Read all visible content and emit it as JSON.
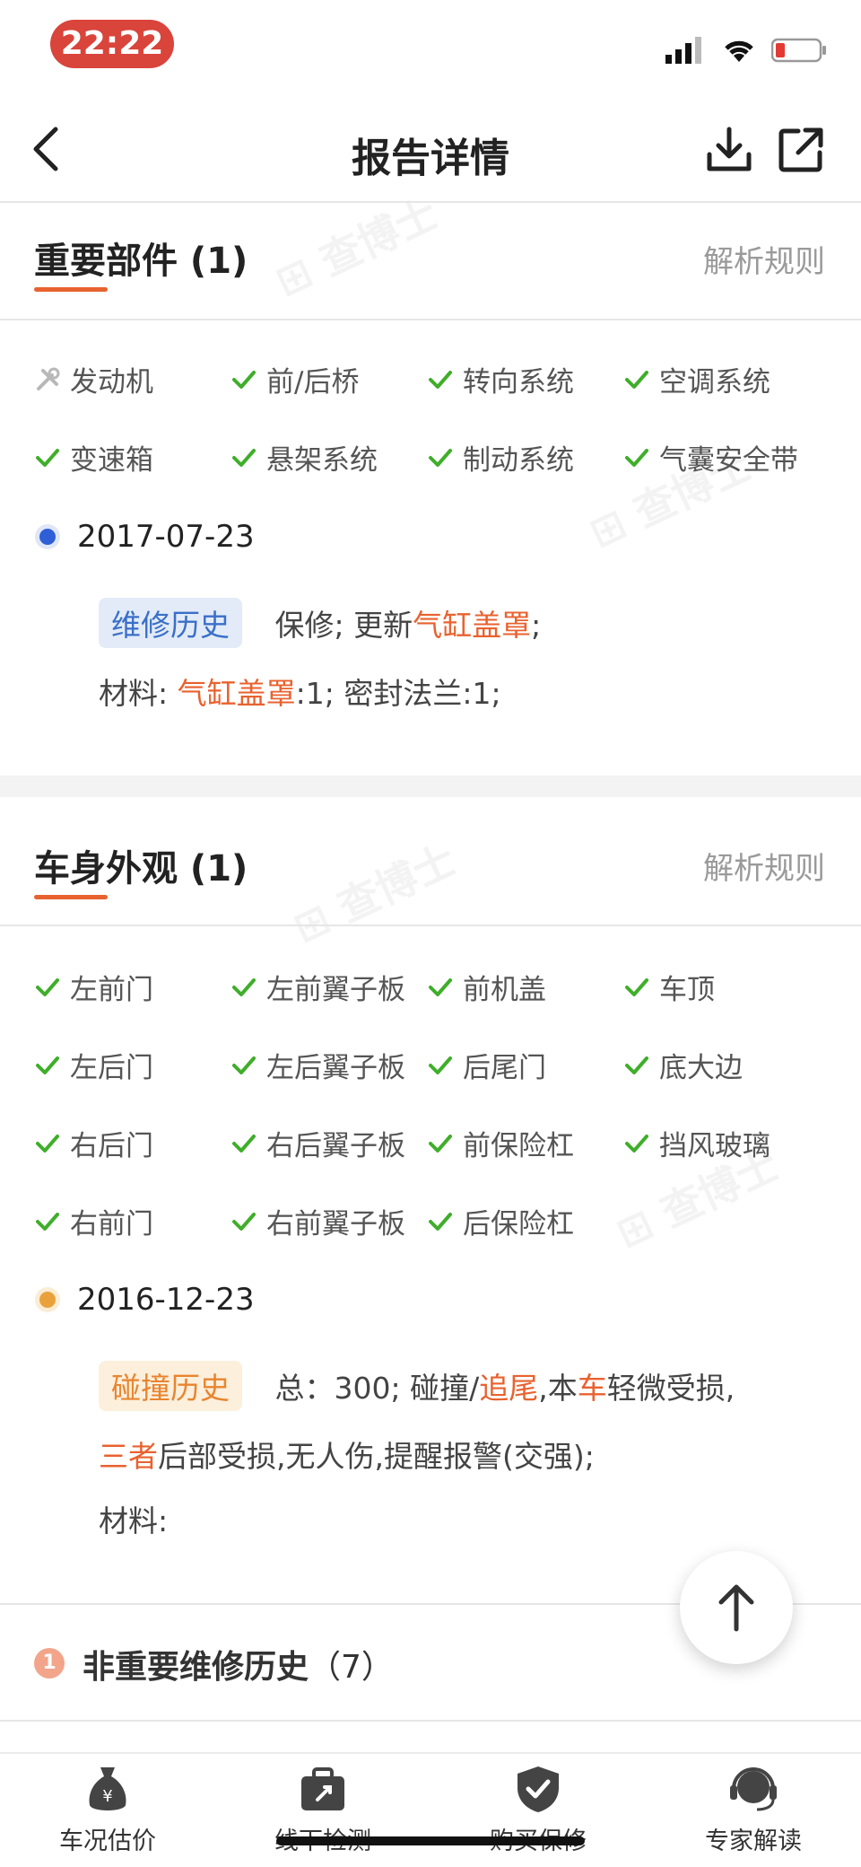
{
  "status_bar": {
    "time": "22:22"
  },
  "nav": {
    "title": "报告详情"
  },
  "important": {
    "title": "重要部件 (1)",
    "rules": "解析规则",
    "items": [
      "发动机",
      "前/后桥",
      "转向系统",
      "空调系统",
      "变速箱",
      "悬架系统",
      "制动系统",
      "气囊安全带"
    ],
    "record": {
      "date": "2017-07-23",
      "tag": "维修历史",
      "line1_plain": "保修; 更新",
      "line1_hl": "气缸盖罩",
      "line1_end": ";",
      "line2_label": "材料:",
      "line2_hl": "气缸盖罩",
      "line2_end": ":1; 密封法兰:1;"
    }
  },
  "body": {
    "title": "车身外观 (1)",
    "rules": "解析规则",
    "items": [
      "左前门",
      "左前翼子板",
      "前机盖",
      "车顶",
      "左后门",
      "左后翼子板",
      "后尾门",
      "底大边",
      "右后门",
      "右后翼子板",
      "前保险杠",
      "挡风玻璃",
      "右前门",
      "右前翼子板",
      "后保险杠"
    ],
    "record": {
      "date": "2016-12-23",
      "tag": "碰撞历史",
      "line1_a": "总：300; 碰撞/",
      "line1_hl1": "追尾",
      "line1_b": ",本",
      "line1_hl2": "车",
      "line1_c": "轻微受损,",
      "line2_hl": "三者",
      "line2_rest": "后部受损,无人伤,提醒报警(交强);",
      "line3": "材料:"
    }
  },
  "non_important": {
    "badge": "1",
    "title": "非重要维修历史",
    "count": "（7）"
  },
  "tabs": [
    {
      "label": "车况估价",
      "icon": "money-bag-icon"
    },
    {
      "label": "线下检测",
      "icon": "toolbox-icon"
    },
    {
      "label": "购买保修",
      "icon": "shield-check-icon"
    },
    {
      "label": "专家解读",
      "icon": "headset-icon"
    }
  ],
  "colors": {
    "accent": "#e8622f",
    "check": "#3fae2a",
    "blue_dot": "#2f5fd6",
    "orange_dot": "#e9a23b"
  }
}
